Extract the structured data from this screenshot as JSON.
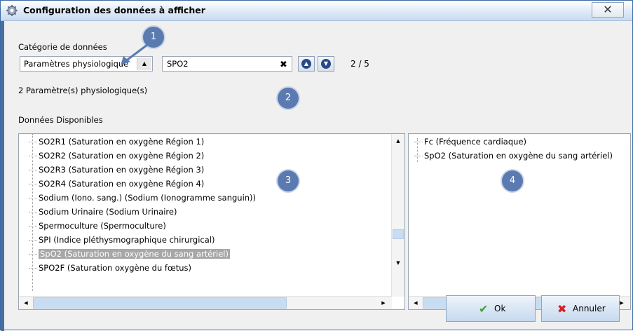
{
  "window": {
    "title": "Configuration des données à afficher",
    "close": "✕"
  },
  "category": {
    "label": "Catégorie de données",
    "selected": "Paramètres physiologique",
    "arrow": "▲"
  },
  "search": {
    "value": "SPO2",
    "clear": "✖",
    "counter": "2 / 5"
  },
  "nav": {
    "up": "▲",
    "down": "▼"
  },
  "count_text": "2 Paramètre(s) physiologique(s)",
  "available_label": "Données Disponibles",
  "available_items": [
    "SO2R1 (Saturation en oxygène Région 1)",
    "SO2R2 (Saturation en oxygène Région 2)",
    "SO2R3 (Saturation en oxygène Région 3)",
    "SO2R4 (Saturation en oxygène Région 4)",
    "Sodium (Iono. sang.) (Sodium (Ionogramme sanguin))",
    "Sodium Urinaire (Sodium Urinaire)",
    "Spermoculture (Spermoculture)",
    "SPI (Indice pléthysmographique chirurgical)",
    "SpO2 (Saturation en oxygène du sang artériel)",
    "SPO2F (Saturation oxygène du fœtus)"
  ],
  "selected_items": [
    "Fc (Fréquence cardiaque)",
    "SpO2 (Saturation en oxygène du sang artériel)"
  ],
  "badges": [
    "1",
    "2",
    "3",
    "4"
  ],
  "buttons": {
    "ok": "Ok",
    "cancel": "Annuler"
  },
  "scroll": {
    "up": "▲",
    "down": "▼",
    "left": "◀",
    "right": "▶"
  },
  "colors": {
    "badge": "#5b7bb0",
    "selection": "#a7a7a7",
    "ok_icon": "#3aa23a",
    "cancel_icon": "#d42020"
  }
}
